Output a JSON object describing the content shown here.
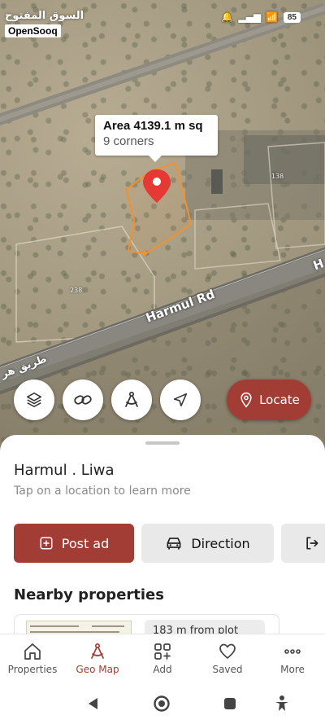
{
  "status_bar": {
    "brand_arabic": "السوق المفتوح",
    "brand_english": "OpenSooq",
    "battery": "85"
  },
  "map": {
    "callout": {
      "area": "Area 4139.1 m sq",
      "corners": "9 corners"
    },
    "road_label_en": "Harmul Rd",
    "road_label_ar": "طريق هر",
    "road_label_edge": "H",
    "plot_numbers": [
      "238",
      "138"
    ],
    "controls": {
      "layers_icon": "layers-icon",
      "link_icon": "link-icon",
      "measure_icon": "compass-measure-icon",
      "navigate_icon": "navigation-arrow-icon",
      "locate_label": "Locate"
    }
  },
  "sheet": {
    "location_title": "Harmul . Liwa",
    "location_subtitle": "Tap on a location to learn more",
    "actions": [
      {
        "label": "Post ad",
        "icon": "plus-square-icon"
      },
      {
        "label": "Direction",
        "icon": "car-icon"
      },
      {
        "label": "",
        "icon": "exit-icon"
      }
    ],
    "nearby_title": "Nearby properties",
    "property_card": {
      "distance_text": "183 m from plot"
    }
  },
  "bottom_nav": {
    "items": [
      {
        "label": "Properties",
        "icon": "home-icon",
        "active": false
      },
      {
        "label": "Geo Map",
        "icon": "compass-measure-icon",
        "active": true
      },
      {
        "label": "Add",
        "icon": "add-grid-icon",
        "active": false
      },
      {
        "label": "Saved",
        "icon": "heart-icon",
        "active": false
      },
      {
        "label": "More",
        "icon": "more-dots-icon",
        "active": false
      }
    ]
  },
  "colors": {
    "accent": "#a13d34",
    "plot_outline": "#f0922e",
    "pin": "#e53935"
  }
}
